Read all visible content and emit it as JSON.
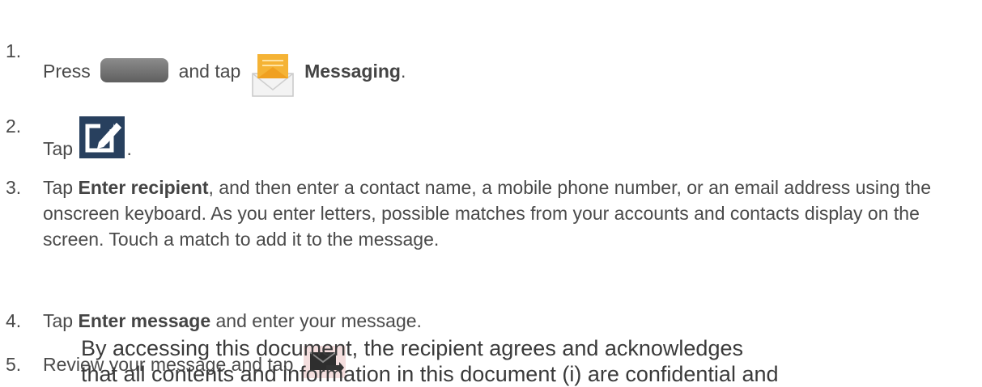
{
  "steps": [
    {
      "number": "1.",
      "before": "Press",
      "home_icon": "home-key-icon",
      "middle": "and tap",
      "app_icon": "messaging-envelope-icon",
      "bold": "Messaging",
      "after": "."
    },
    {
      "number": "2.",
      "before": "Tap",
      "icon": "compose-icon",
      "after": "."
    },
    {
      "number": "3.",
      "before": "Tap",
      "bold": "Enter recipient",
      "after": ", and then enter a contact name, a mobile phone number, or an email address using the onscreen keyboard. As you enter letters, possible matches from your accounts and contacts display on the screen. Touch a match to add it to the message."
    },
    {
      "number": "4.",
      "before": "Tap",
      "bold": "Enter message",
      "after": "and enter your message."
    },
    {
      "number": "5.",
      "before": "Review your message and tap",
      "icon": "send-icon"
    }
  ],
  "overlay": {
    "line1": "By accessing this document, the recipient agrees and acknowledges",
    "line2": "that all contents and information in this document (i) are confidential and"
  }
}
